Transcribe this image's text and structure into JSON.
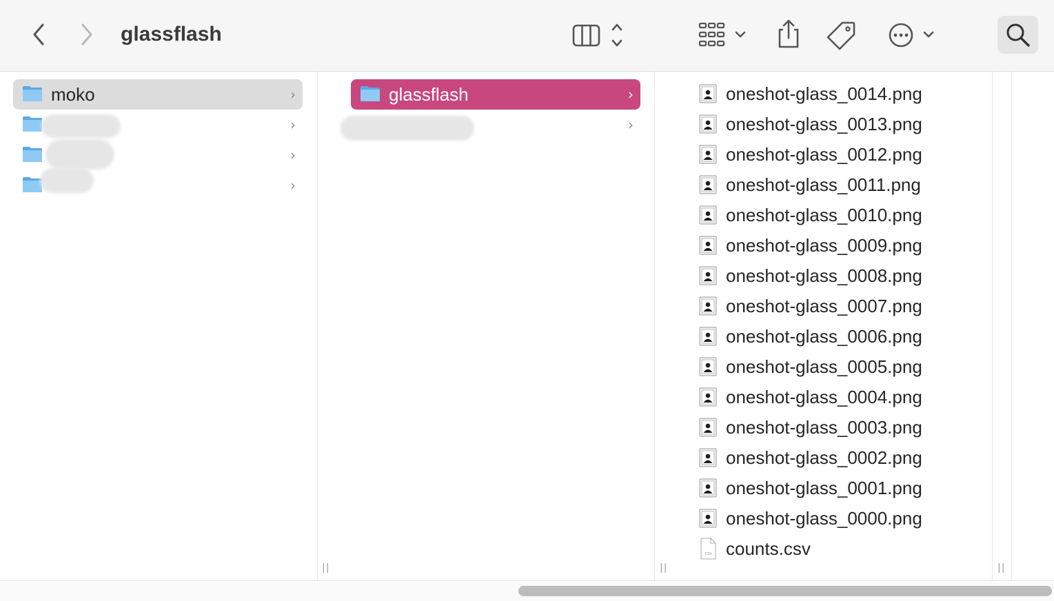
{
  "window": {
    "title": "glassflash"
  },
  "toolbar": {
    "back_icon": "chevron-left-icon",
    "forward_icon": "chevron-right-icon",
    "view_icon": "column-view-icon",
    "group_icon": "grid-group-icon",
    "share_icon": "share-icon",
    "tag_icon": "tag-icon",
    "more_icon": "ellipsis-circle-icon",
    "search_icon": "search-icon"
  },
  "columns": [
    {
      "items": [
        {
          "label": "moko",
          "selected": true
        },
        {
          "label": ""
        },
        {
          "label": ""
        },
        {
          "label": ""
        }
      ]
    },
    {
      "items": [
        {
          "label": "glassflash",
          "selected": true
        },
        {
          "label": ""
        }
      ]
    },
    {
      "files": [
        {
          "name": "oneshot-glass_0014.png",
          "kind": "image"
        },
        {
          "name": "oneshot-glass_0013.png",
          "kind": "image"
        },
        {
          "name": "oneshot-glass_0012.png",
          "kind": "image"
        },
        {
          "name": "oneshot-glass_0011.png",
          "kind": "image"
        },
        {
          "name": "oneshot-glass_0010.png",
          "kind": "image"
        },
        {
          "name": "oneshot-glass_0009.png",
          "kind": "image"
        },
        {
          "name": "oneshot-glass_0008.png",
          "kind": "image"
        },
        {
          "name": "oneshot-glass_0007.png",
          "kind": "image"
        },
        {
          "name": "oneshot-glass_0006.png",
          "kind": "image"
        },
        {
          "name": "oneshot-glass_0005.png",
          "kind": "image"
        },
        {
          "name": "oneshot-glass_0004.png",
          "kind": "image"
        },
        {
          "name": "oneshot-glass_0003.png",
          "kind": "image"
        },
        {
          "name": "oneshot-glass_0002.png",
          "kind": "image"
        },
        {
          "name": "oneshot-glass_0001.png",
          "kind": "image"
        },
        {
          "name": "oneshot-glass_0000.png",
          "kind": "image"
        },
        {
          "name": "counts.csv",
          "kind": "csv",
          "badge": "CSV"
        }
      ]
    }
  ],
  "colors": {
    "selection_active": "#c8477e",
    "selection_inactive": "#dcdcdc",
    "folder_blue": "#6fb6ec"
  }
}
